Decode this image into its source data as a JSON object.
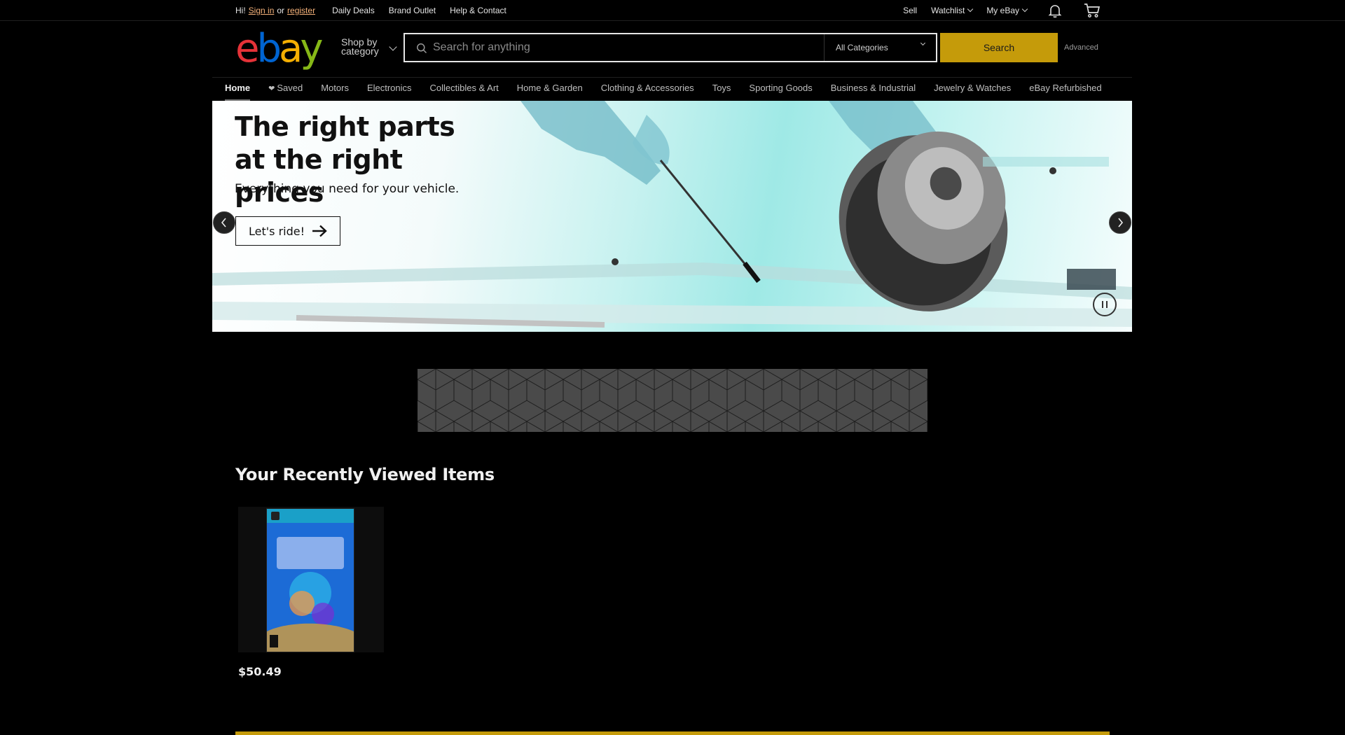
{
  "topbar": {
    "greeting": "Hi!",
    "sign_in": "Sign in",
    "or": "or",
    "register": "register",
    "links": [
      "Daily Deals",
      "Brand Outlet",
      "Help & Contact"
    ],
    "right": {
      "sell": "Sell",
      "watchlist": "Watchlist",
      "my_ebay": "My eBay"
    }
  },
  "header": {
    "logo": {
      "e": "e",
      "b": "b",
      "a": "a",
      "y": "y"
    },
    "shop_by_line1": "Shop by",
    "shop_by_line2": "category",
    "search_placeholder": "Search for anything",
    "category": "All Categories",
    "search_label": "Search",
    "advanced": "Advanced"
  },
  "nav": {
    "items": [
      "Home",
      "Saved",
      "Motors",
      "Electronics",
      "Collectibles & Art",
      "Home & Garden",
      "Clothing & Accessories",
      "Toys",
      "Sporting Goods",
      "Business & Industrial",
      "Jewelry & Watches",
      "eBay Refurbished"
    ]
  },
  "hero": {
    "title": "The right parts at the right prices",
    "subtitle": "Everything you need for your vehicle.",
    "cta": "Let's ride!"
  },
  "recently_viewed": {
    "title": "Your Recently Viewed Items",
    "items": [
      {
        "price": "$50.49"
      }
    ]
  },
  "colors": {
    "accent": "#c59b0a",
    "link": "#f5b27a",
    "background": "#000000"
  }
}
